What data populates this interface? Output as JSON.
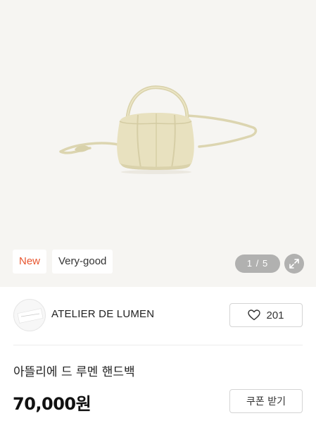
{
  "gallery": {
    "image_alt": "product-handbag",
    "badge_new": "New",
    "badge_condition": "Very-good",
    "pager_current": "1",
    "pager_separator": "/",
    "pager_total": "5",
    "zoom_icon": "expand-icon",
    "background_color": "#f6f5f2",
    "badge_new_color": "#e8562f"
  },
  "seller": {
    "name": "ATELIER DE LUMEN",
    "like_count": "201",
    "like_icon": "heart-outline-icon"
  },
  "product": {
    "title": "아뜰리에 드 루멘 핸드백",
    "price": "70,000원",
    "coupon_label": "쿠폰 받기"
  }
}
